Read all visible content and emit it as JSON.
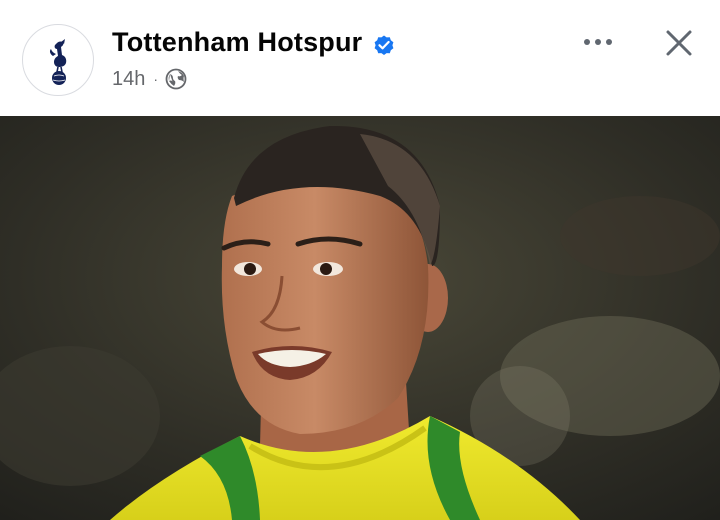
{
  "post": {
    "page_name": "Tottenham Hotspur",
    "timestamp": "14h",
    "separator": "·",
    "audience_icon": "globe-icon",
    "verified_icon": "verified-badge-icon",
    "avatar_icon": "tottenham-crest-icon"
  },
  "actions": {
    "more_icon": "more-options-icon",
    "close_icon": "close-icon"
  },
  "photo": {
    "subject": "smiling man in yellow and green jersey"
  },
  "colors": {
    "verified_blue": "#1877f2",
    "secondary_text": "#65676b",
    "primary_text": "#050505",
    "crest_navy": "#132257",
    "jersey_yellow": "#e8e21e",
    "jersey_green": "#2f8a2a"
  }
}
